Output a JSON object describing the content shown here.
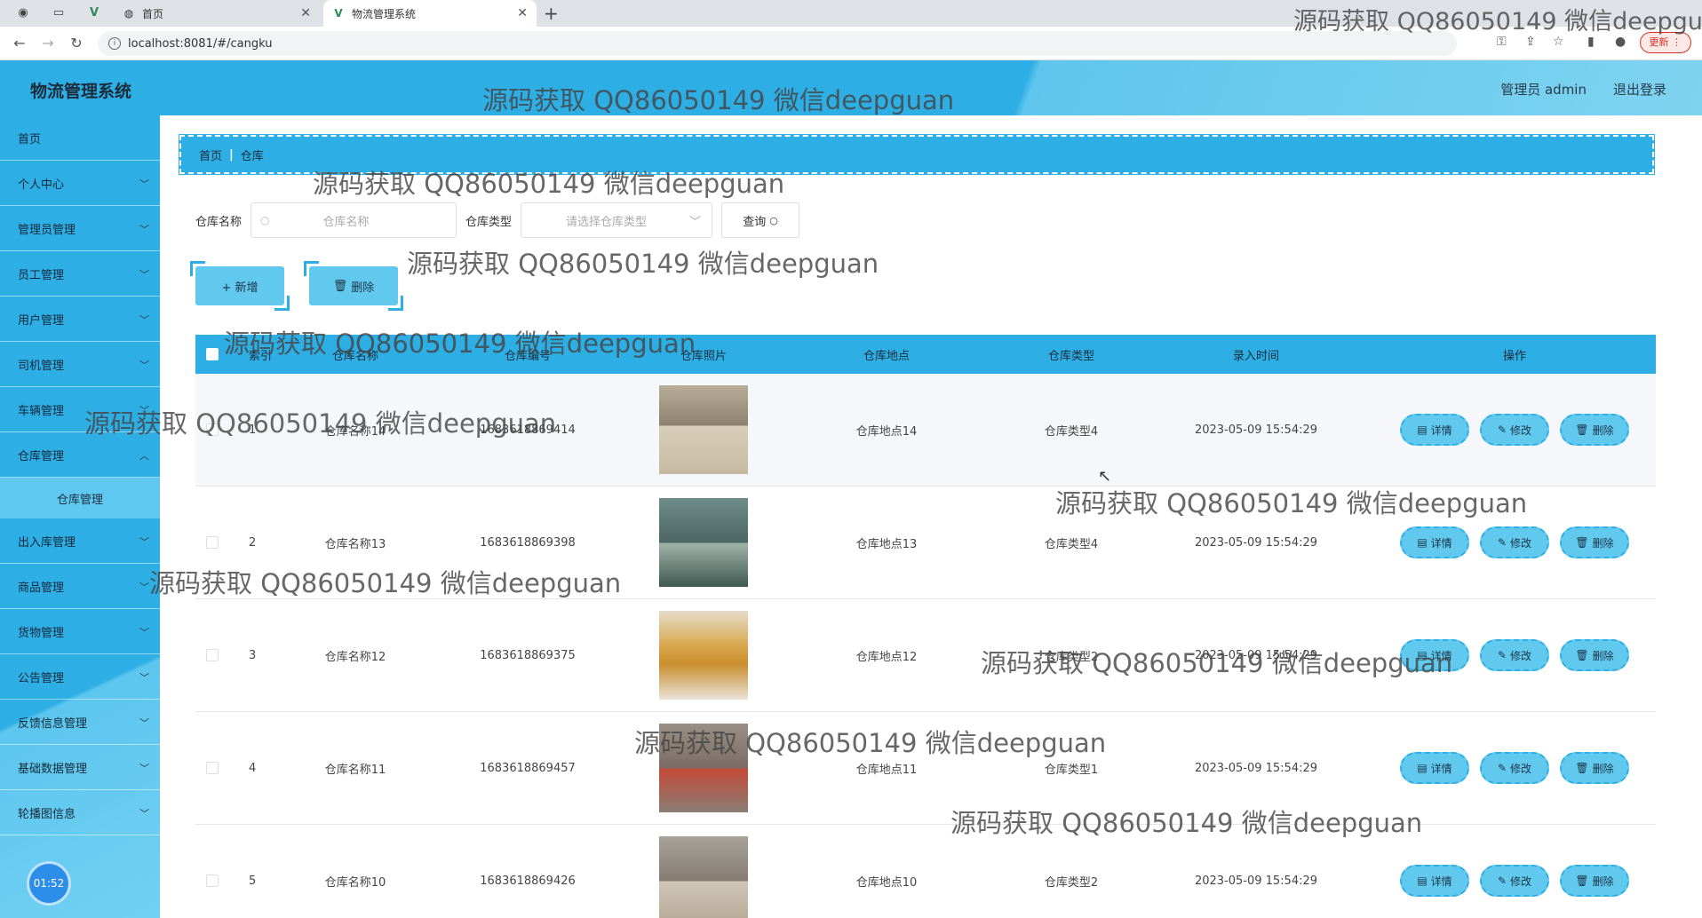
{
  "browser": {
    "tabs": [
      {
        "title": "首页"
      },
      {
        "title": "物流管理系统"
      }
    ],
    "url": "localhost:8081/#/cangku",
    "update_label": "更新"
  },
  "app": {
    "title": "物流管理系统",
    "user": "管理员 admin",
    "logout": "退出登录"
  },
  "sidebar": {
    "items": [
      {
        "label": "首页"
      },
      {
        "label": "个人中心"
      },
      {
        "label": "管理员管理"
      },
      {
        "label": "员工管理"
      },
      {
        "label": "用户管理"
      },
      {
        "label": "司机管理"
      },
      {
        "label": "车辆管理"
      },
      {
        "label": "仓库管理"
      },
      {
        "label": "出入库管理"
      },
      {
        "label": "商品管理"
      },
      {
        "label": "货物管理"
      },
      {
        "label": "公告管理"
      },
      {
        "label": "反馈信息管理"
      },
      {
        "label": "基础数据管理"
      },
      {
        "label": "轮播图信息"
      }
    ],
    "submenu": "仓库管理",
    "timer": "01:52"
  },
  "breadcrumb": {
    "home": "首页",
    "current": "仓库"
  },
  "search": {
    "name_label": "仓库名称",
    "name_placeholder": "仓库名称",
    "type_label": "仓库类型",
    "type_placeholder": "请选择仓库类型",
    "query_label": "查询"
  },
  "actions": {
    "add": "+ 新增",
    "delete": "删除"
  },
  "table": {
    "headers": [
      "索引",
      "仓库名称",
      "仓库编号",
      "仓库照片",
      "仓库地点",
      "仓库类型",
      "录入时间",
      "操作"
    ],
    "rows": [
      {
        "idx": "1",
        "name": "仓库名称14",
        "code": "1683618869414",
        "loc": "仓库地点14",
        "type": "仓库类型4",
        "time": "2023-05-09 15:54:29"
      },
      {
        "idx": "2",
        "name": "仓库名称13",
        "code": "1683618869398",
        "loc": "仓库地点13",
        "type": "仓库类型4",
        "time": "2023-05-09 15:54:29"
      },
      {
        "idx": "3",
        "name": "仓库名称12",
        "code": "1683618869375",
        "loc": "仓库地点12",
        "type": "仓库类型2",
        "time": "2023-05-09 15:54:29"
      },
      {
        "idx": "4",
        "name": "仓库名称11",
        "code": "1683618869457",
        "loc": "仓库地点11",
        "type": "仓库类型1",
        "time": "2023-05-09 15:54:29"
      },
      {
        "idx": "5",
        "name": "仓库名称10",
        "code": "1683618869426",
        "loc": "仓库地点10",
        "type": "仓库类型2",
        "time": "2023-05-09 15:54:29"
      }
    ],
    "ops": {
      "detail": "详情",
      "edit": "修改",
      "delete": "删除"
    }
  },
  "watermark": "源码获取 QQ86050149 微信deepguan",
  "colors": {
    "primary": "#2daee5",
    "light": "#62c9ee"
  }
}
